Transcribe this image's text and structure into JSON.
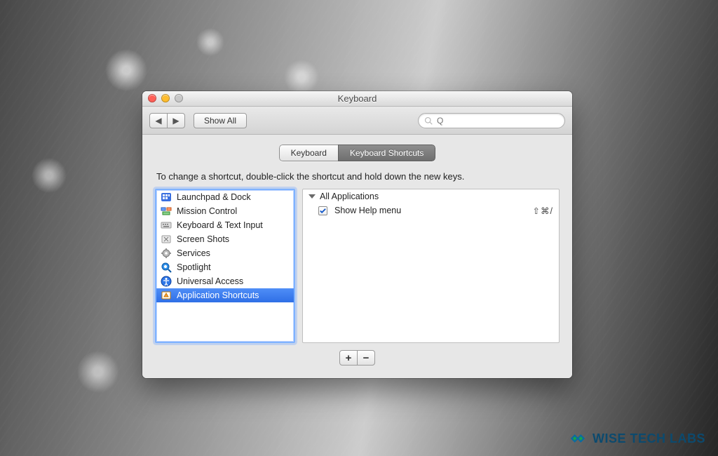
{
  "watermark": {
    "text": "WISE TECH LABS"
  },
  "window": {
    "title": "Keyboard",
    "toolbar": {
      "back_label": "◀",
      "forward_label": "▶",
      "show_all_label": "Show All",
      "search_placeholder": "Q"
    },
    "tabs": [
      {
        "label": "Keyboard",
        "selected": false
      },
      {
        "label": "Keyboard Shortcuts",
        "selected": true
      }
    ],
    "instruction": "To change a shortcut, double-click the shortcut and hold down the new keys.",
    "categories": [
      {
        "icon": "launchpad-icon",
        "label": "Launchpad & Dock",
        "selected": false
      },
      {
        "icon": "mission-control-icon",
        "label": "Mission Control",
        "selected": false
      },
      {
        "icon": "keyboard-text-icon",
        "label": "Keyboard & Text Input",
        "selected": false
      },
      {
        "icon": "screenshot-icon",
        "label": "Screen Shots",
        "selected": false
      },
      {
        "icon": "services-icon",
        "label": "Services",
        "selected": false
      },
      {
        "icon": "spotlight-icon",
        "label": "Spotlight",
        "selected": false
      },
      {
        "icon": "universal-access-icon",
        "label": "Universal Access",
        "selected": false
      },
      {
        "icon": "app-shortcuts-icon",
        "label": "Application Shortcuts",
        "selected": true
      }
    ],
    "details": {
      "group_label": "All Applications",
      "items": [
        {
          "checked": true,
          "label": "Show Help menu",
          "shortcut": "⇧⌘/"
        }
      ]
    },
    "buttons": {
      "add_label": "+",
      "remove_label": "−"
    }
  }
}
